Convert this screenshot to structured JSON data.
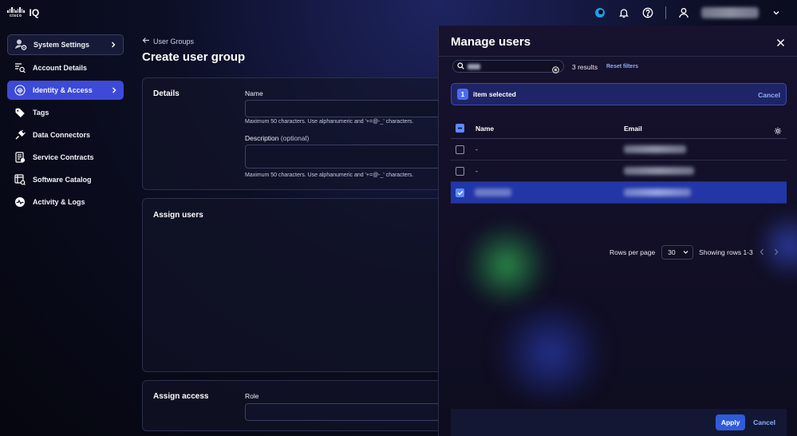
{
  "brand": {
    "logo_sub": "cisco",
    "product": "IQ"
  },
  "icons": {
    "status": "circle-logo-icon",
    "bell": "bell-icon",
    "help": "help-icon",
    "user": "user-icon",
    "chevron": "chevron-down-icon"
  },
  "sidebar": {
    "items": [
      {
        "label": "System Settings",
        "icon": "settings-user-icon"
      },
      {
        "label": "Account Details",
        "icon": "list-search-icon"
      },
      {
        "label": "Identity & Access",
        "icon": "fingerprint-icon"
      },
      {
        "label": "Tags",
        "icon": "tag-icon"
      },
      {
        "label": "Data Connectors",
        "icon": "plug-icon"
      },
      {
        "label": "Service Contracts",
        "icon": "contract-icon"
      },
      {
        "label": "Software Catalog",
        "icon": "catalog-icon"
      },
      {
        "label": "Activity & Logs",
        "icon": "activity-icon"
      }
    ]
  },
  "main": {
    "back_label": "User Groups",
    "title": "Create user group",
    "details": {
      "title": "Details",
      "name_label": "Name",
      "name_help": "Maximum 50 characters. Use alphanumeric and '+=@-_' characters.",
      "desc_label": "Description",
      "desc_optional": "(optional)",
      "desc_help": "Maximum 50 characters. Use alphanumeric and '+=@-_' characters."
    },
    "assign_users": {
      "title": "Assign users"
    },
    "assign_access": {
      "title": "Assign access",
      "role_label": "Role"
    }
  },
  "panel": {
    "title": "Manage users",
    "results": "3 results",
    "reset_filters": "Reset filters",
    "selected_count": "1",
    "selected_text": "item selected",
    "selected_cancel": "Cancel",
    "columns": {
      "name": "Name",
      "email": "Email"
    },
    "rows": [
      {
        "name": "-",
        "selected": false
      },
      {
        "name": "-",
        "selected": false
      },
      {
        "name": "",
        "selected": true
      }
    ],
    "pager": {
      "rows_per_page_label": "Rows per page",
      "rows_per_page_value": "30",
      "showing": "Showing rows 1-3"
    },
    "apply_label": "Apply",
    "cancel_label": "Cancel"
  }
}
